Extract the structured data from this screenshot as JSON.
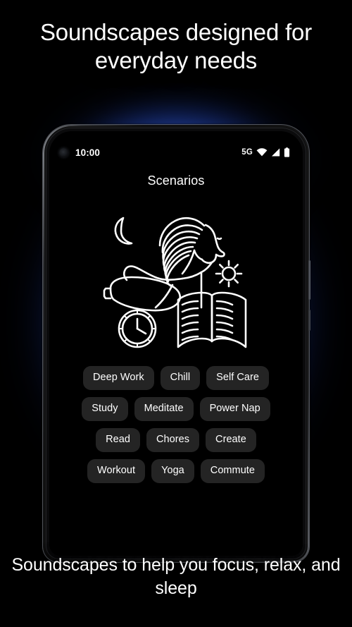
{
  "promo": {
    "headline": "Soundscapes designed for everyday needs",
    "caption": "Soundscapes to help you focus, relax, and sleep"
  },
  "phone": {
    "status_bar": {
      "time": "10:00",
      "network_label": "5G",
      "icons": [
        "camera-punch-hole",
        "wifi-icon",
        "cellular-signal-icon",
        "battery-icon"
      ]
    },
    "screen": {
      "title": "Scenarios",
      "illustration": {
        "name": "scenarios-illustration",
        "elements": [
          "horse-head",
          "flowing-mane",
          "crescent-moon",
          "sun",
          "sleep-mask",
          "open-book",
          "clock"
        ],
        "stroke_color": "#ffffff"
      },
      "chip_rows": [
        [
          "Deep Work",
          "Chill",
          "Self Care"
        ],
        [
          "Study",
          "Meditate",
          "Power Nap"
        ],
        [
          "Read",
          "Chores",
          "Create"
        ],
        [
          "Workout",
          "Yoga",
          "Commute"
        ]
      ]
    }
  },
  "colors": {
    "background": "#000000",
    "glow": "#2447b8",
    "chip_background": "#242424",
    "text": "#ffffff"
  }
}
